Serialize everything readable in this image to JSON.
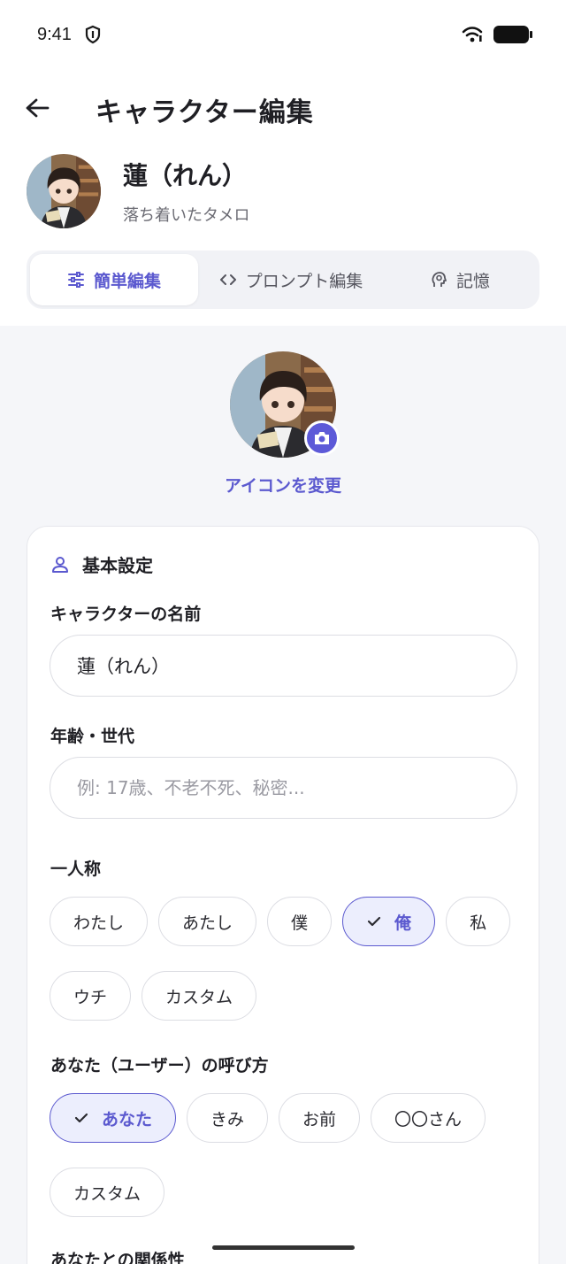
{
  "status": {
    "time": "9:41"
  },
  "header": {
    "title": "キャラクター編集"
  },
  "profile": {
    "name": "蓮（れん）",
    "subtitle": "落ち着いたタメロ"
  },
  "tabs": [
    {
      "label": "簡単編集",
      "icon": "sliders-icon",
      "active": true
    },
    {
      "label": "プロンプト編集",
      "icon": "code-icon",
      "active": false
    },
    {
      "label": "記憶",
      "icon": "brain-head-icon",
      "active": false
    }
  ],
  "icon_section": {
    "change_label": "アイコンを変更"
  },
  "basic": {
    "title": "基本設定",
    "name_label": "キャラクターの名前",
    "name_value": "蓮（れん）",
    "age_label": "年齢・世代",
    "age_placeholder": "例: 17歳、不老不死、秘密...",
    "first_person_label": "一人称",
    "first_person_options": [
      "わたし",
      "あたし",
      "僕",
      "俺",
      "私",
      "ウチ",
      "カスタム"
    ],
    "first_person_selected": "俺",
    "call_user_label": "あなた（ユーザー）の呼び方",
    "call_user_options": [
      "あなた",
      "きみ",
      "お前",
      "〇〇さん",
      "カスタム"
    ],
    "call_user_selected": "あなた",
    "relation_label": "あなたとの関係性"
  },
  "colors": {
    "accent": "#5b59cf",
    "accent_bg": "#eceefd"
  }
}
